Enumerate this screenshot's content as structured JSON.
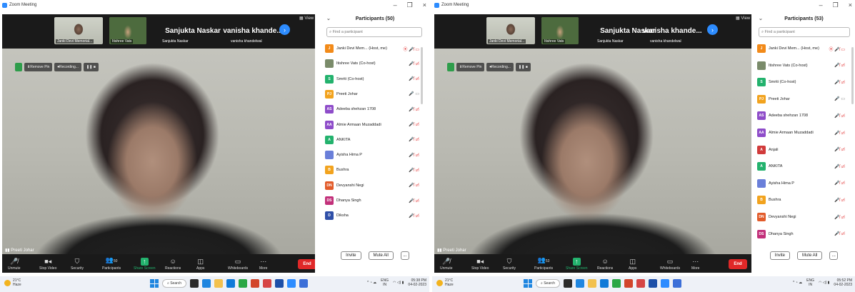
{
  "window": {
    "title": "Zoom Meeting"
  },
  "left": {
    "participants_title": "Participants (50)",
    "search_placeholder": "Find a participant",
    "strip": {
      "tile1": "Janki Devi Memorial...",
      "tile2": "Itishree Vats",
      "name_big1": "Sanjukta Naskar",
      "name_big2": "vanisha khande...",
      "name_sub1": "Sanjukta Naskar",
      "name_sub2": "vanisha khandelwal",
      "view": "View"
    },
    "video_name": "Preeti Johar",
    "rec": {
      "remove_pin": "Remove Pin",
      "recording": "Recording..."
    },
    "participants": [
      {
        "initials": "J",
        "name": "Janki  Devi Mem... (Host, me)",
        "color": "#f28a19",
        "icons": "⦿ 🎤̸ ▭",
        "gray": false
      },
      {
        "initials": "",
        "name": "Itishree Vats (Co-host)",
        "color": "#7a8b6a",
        "icons": "🎤̸ ▭̸",
        "gray": false
      },
      {
        "initials": "S",
        "name": "Smriti (Co-host)",
        "color": "#23b26d",
        "icons": "🎤̸ ▭̸",
        "gray": false
      },
      {
        "initials": "PJ",
        "name": "Preeti Johar",
        "color": "#f2a31e",
        "icons": "🎤 ▭",
        "gray": true
      },
      {
        "initials": "AS",
        "name": "Adeeba shehzan 1708",
        "color": "#8e4cc9",
        "icons": "🎤̸ ▭̸",
        "gray": false
      },
      {
        "initials": "AA",
        "name": "Almie Armaan Muzaddadi",
        "color": "#8e4cc9",
        "icons": "🎤̸ ▭̸",
        "gray": false
      },
      {
        "initials": "A",
        "name": "ANKITA",
        "color": "#23b26d",
        "icons": "🎤̸ ▭̸",
        "gray": false
      },
      {
        "initials": "",
        "name": "Ayisha Hima P",
        "color": "#6a7fd9",
        "icons": "🎤̸ ▭̸",
        "gray": false
      },
      {
        "initials": "B",
        "name": "Bushra",
        "color": "#f2a31e",
        "icons": "🎤̸ ▭̸",
        "gray": false
      },
      {
        "initials": "DN",
        "name": "Devyanshi Negi",
        "color": "#e25b2a",
        "icons": "🎤̸ ▭̸",
        "gray": false
      },
      {
        "initials": "DS",
        "name": "Dhanya Singh",
        "color": "#c2307a",
        "icons": "🎤̸ ▭̸",
        "gray": false
      },
      {
        "initials": "D",
        "name": "Diksha",
        "color": "#2f4fa8",
        "icons": "🎤̸ ▭̸",
        "gray": false
      }
    ],
    "participants_count": "50",
    "clock_time": "05:38 PM",
    "clock_date": "04-02-2023"
  },
  "right": {
    "participants_title": "Participants (53)",
    "search_placeholder": "Find a participant",
    "strip": {
      "tile1": "Janki  Devi Memorial...",
      "tile2": "Itishree Vats",
      "name_big1": "Sanjukta Naskar",
      "name_big2": "vanisha khande...",
      "name_sub1": "Sanjukta Naskar",
      "name_sub2": "vanisha khandelwal",
      "view": "View"
    },
    "video_name": "Preeti Johar",
    "rec": {
      "remove_pin": "Remove Pin",
      "recording": "Recording..."
    },
    "participants": [
      {
        "initials": "J",
        "name": "Janki  Devi Mem... (Host, me)",
        "color": "#f28a19",
        "icons": "⦿ 🎤̸ ▭",
        "gray": false
      },
      {
        "initials": "",
        "name": "Itishree Vats (Co-host)",
        "color": "#7a8b6a",
        "icons": "🎤̸ ▭̸",
        "gray": false
      },
      {
        "initials": "S",
        "name": "Smriti (Co-host)",
        "color": "#23b26d",
        "icons": "🎤̸ ▭̸",
        "gray": false
      },
      {
        "initials": "PJ",
        "name": "Preeti Johar",
        "color": "#f2a31e",
        "icons": "🎤 ▭",
        "gray": true
      },
      {
        "initials": "AS",
        "name": "Adeeba shehzan 1708",
        "color": "#8e4cc9",
        "icons": "🎤̸ ▭̸",
        "gray": false
      },
      {
        "initials": "AA",
        "name": "Almie Armaan Muzaddadi",
        "color": "#8e4cc9",
        "icons": "🎤̸ ▭̸",
        "gray": false
      },
      {
        "initials": "A",
        "name": "Anjali",
        "color": "#d13b3b",
        "icons": "🎤̸ ▭̸",
        "gray": false
      },
      {
        "initials": "A",
        "name": "ANKITA",
        "color": "#23b26d",
        "icons": "🎤̸ ▭̸",
        "gray": false
      },
      {
        "initials": "",
        "name": "Ayisha Hima P",
        "color": "#6a7fd9",
        "icons": "🎤̸ ▭̸",
        "gray": false
      },
      {
        "initials": "B",
        "name": "Bushra",
        "color": "#f2a31e",
        "icons": "🎤̸ ▭̸",
        "gray": false
      },
      {
        "initials": "DN",
        "name": "Devyanshi Negi",
        "color": "#e25b2a",
        "icons": "🎤̸ ▭̸",
        "gray": false
      },
      {
        "initials": "DS",
        "name": "Dhanya Singh",
        "color": "#c2307a",
        "icons": "🎤̸ ▭̸",
        "gray": false
      }
    ],
    "participants_count": "53",
    "clock_time": "05:52 PM",
    "clock_date": "04-02-2023"
  },
  "toolbar": {
    "unmute": "Unmute",
    "stop_video": "Stop Video",
    "security": "Security",
    "participants": "Participants",
    "share_screen": "Share Screen",
    "reactions": "Reactions",
    "apps": "Apps",
    "whiteboards": "Whiteboards",
    "more": "More",
    "end": "End"
  },
  "panel_footer": {
    "invite": "Invite",
    "mute_all": "Mute All",
    "more": "..."
  },
  "taskbar": {
    "temp": "21°C",
    "weather": "Haze",
    "search": "Search",
    "lang1": "ENG",
    "lang2": "IN"
  },
  "colors": {
    "zoom_blue": "#2d8cff",
    "end_red": "#e02828",
    "share_green": "#23b26d"
  }
}
